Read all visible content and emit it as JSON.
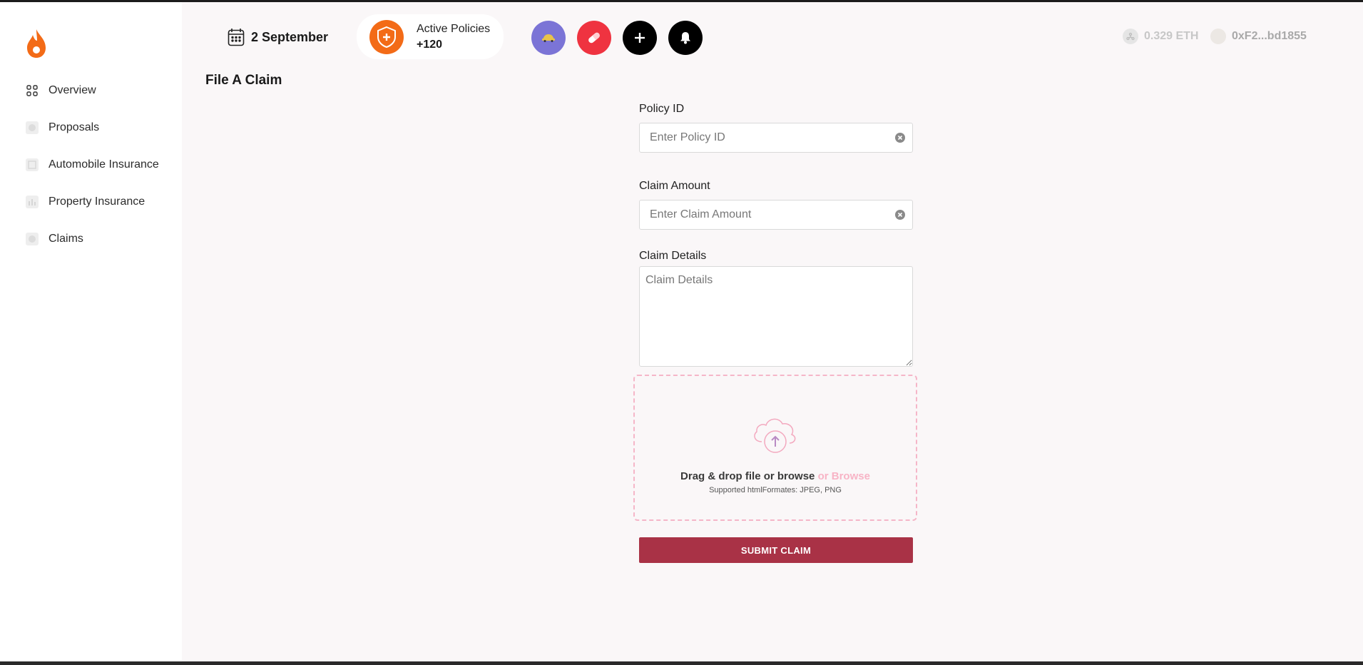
{
  "sidebar": {
    "logo_icon": "flame-logo",
    "items": [
      {
        "label": "Overview",
        "icon": "grid-icon"
      },
      {
        "label": "Proposals",
        "icon": "chat-icon"
      },
      {
        "label": "Automobile Insurance",
        "icon": "document-icon"
      },
      {
        "label": "Property Insurance",
        "icon": "bar-chart-icon"
      },
      {
        "label": "Claims",
        "icon": "chat-icon"
      }
    ]
  },
  "header": {
    "date": "2 September",
    "active_policies": {
      "label": "Active Policies",
      "count": "+120"
    },
    "action_buttons": [
      {
        "icon": "car-icon",
        "color": "#7b74d6"
      },
      {
        "icon": "pill-icon",
        "color": "#ef3340"
      },
      {
        "icon": "plus-icon",
        "color": "#000000"
      },
      {
        "icon": "bell-icon",
        "color": "#000000"
      }
    ],
    "wallet": {
      "balance": "0.329 ETH",
      "address": "0xF2...bd1855"
    }
  },
  "main": {
    "title": "File A Claim",
    "policy_id": {
      "label": "Policy ID",
      "placeholder": "Enter Policy ID",
      "value": ""
    },
    "claim_amount": {
      "label": "Claim Amount",
      "placeholder": "Enter Claim Amount",
      "value": ""
    },
    "claim_details": {
      "label": "Claim Details",
      "placeholder": "Claim Details",
      "value": ""
    },
    "upload": {
      "text": "Drag & drop file or browse",
      "browse": "or Browse",
      "formats": "Supported htmlFormates: JPEG, PNG"
    },
    "submit_label": "SUBMIT CLAIM"
  },
  "colors": {
    "accent": "#a93246",
    "orange": "#f36b17",
    "dropzone_border": "#f5b6c8"
  }
}
